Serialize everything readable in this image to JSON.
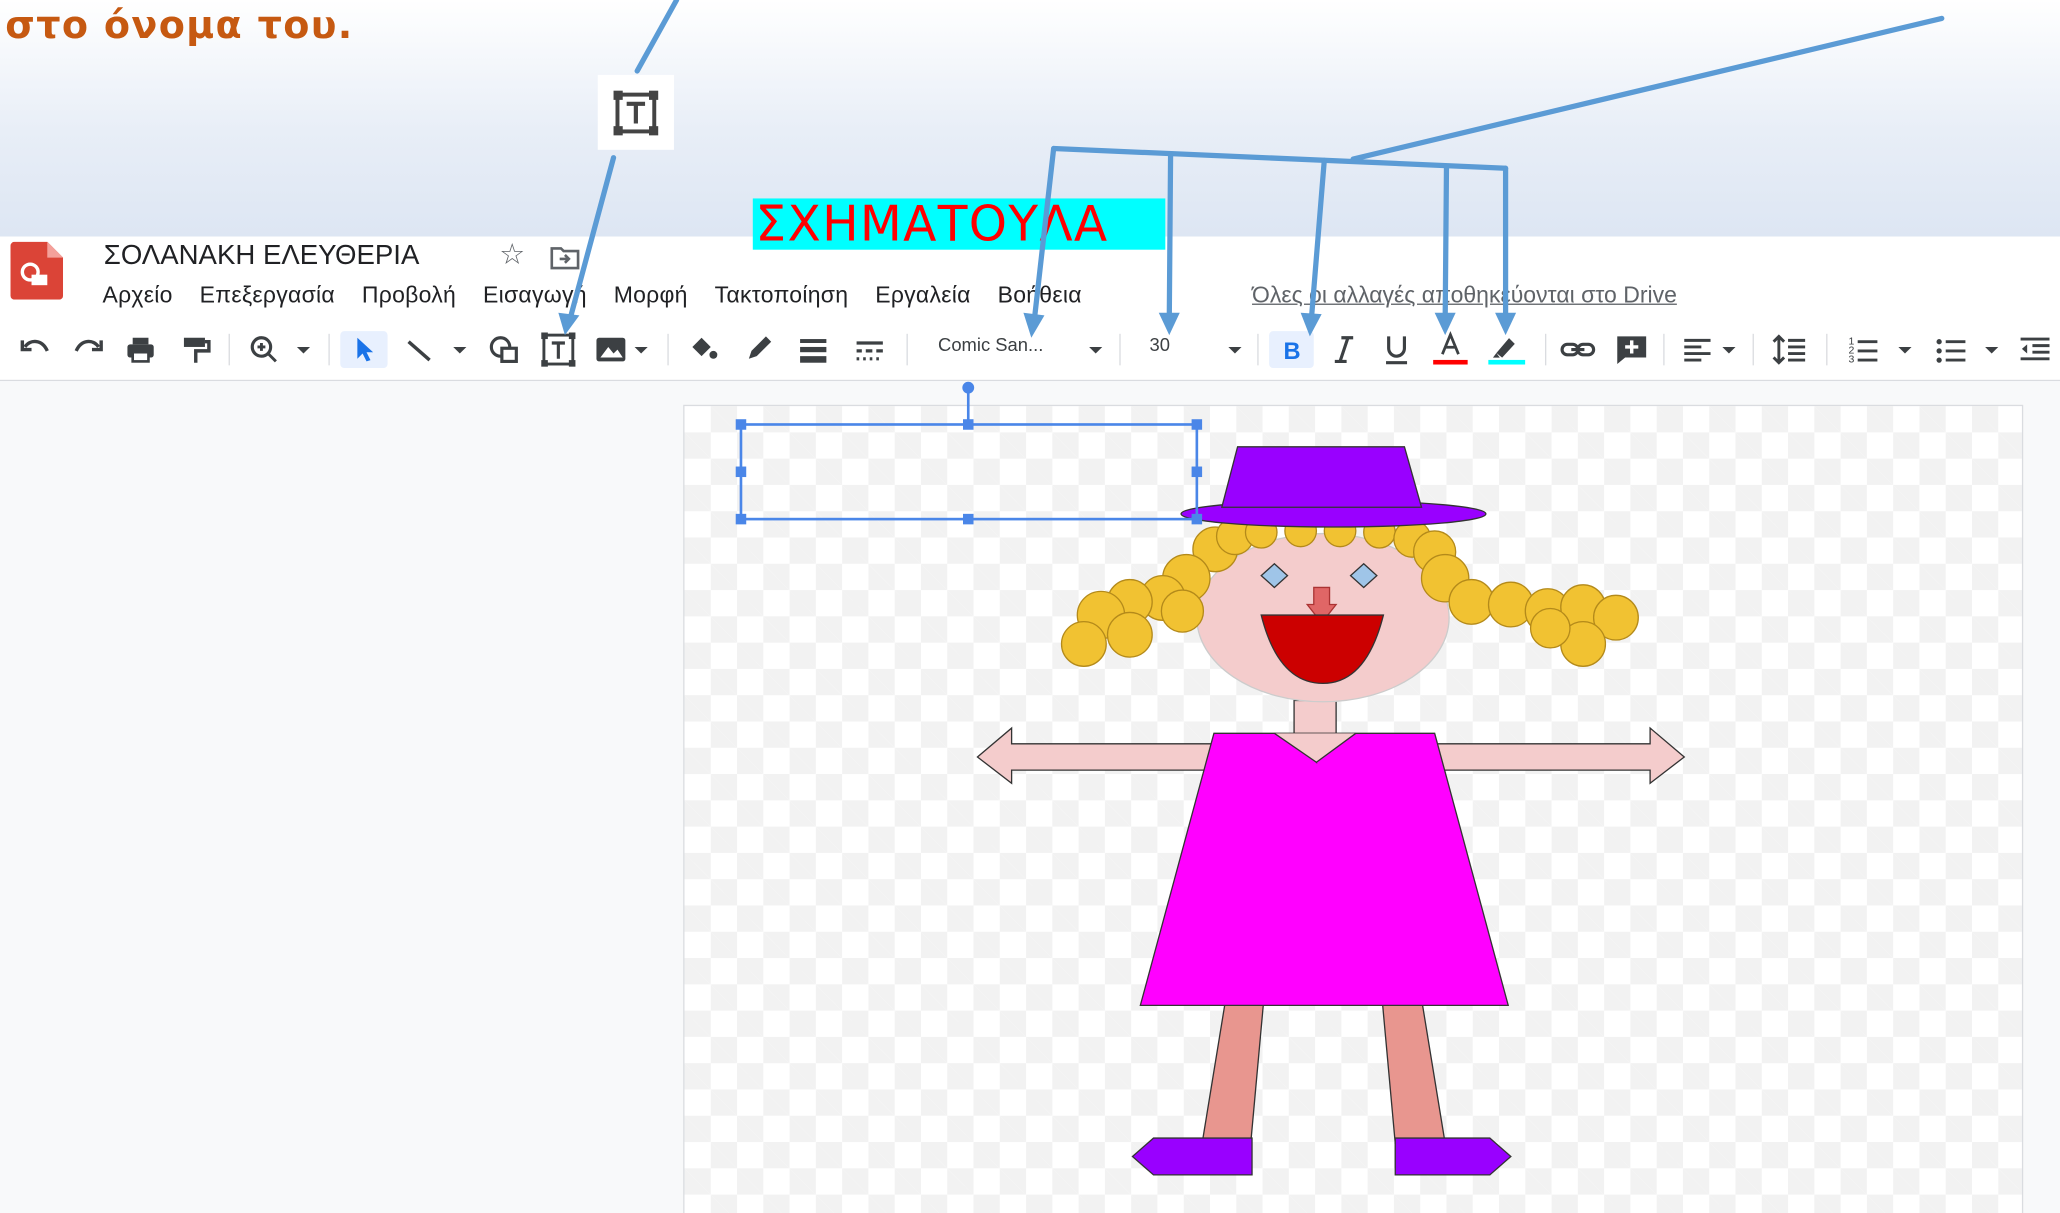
{
  "caption": "στο όνομα του.",
  "document": {
    "title": "ΣΟΛΑΝΑΚΗ ΕΛΕΥΘΕΡΙΑ",
    "saved_status": "Όλες οι αλλαγές αποθηκεύονται στο Drive"
  },
  "menu": [
    "Αρχείο",
    "Επεξεργασία",
    "Προβολή",
    "Εισαγωγή",
    "Μορφή",
    "Τακτοποίηση",
    "Εργαλεία",
    "Βοήθεια"
  ],
  "toolbar": {
    "font_family": "Comic San...",
    "font_size": "30",
    "text_color": "#ff0000",
    "highlight_color": "#00ffff"
  },
  "canvas": {
    "textbox_text": "ΣΧΗΜΑΤΟΥΛΑ"
  },
  "colors": {
    "accent": "#1a73e8",
    "callout_lines": "#5b9bd5",
    "caption": "#c65911"
  }
}
